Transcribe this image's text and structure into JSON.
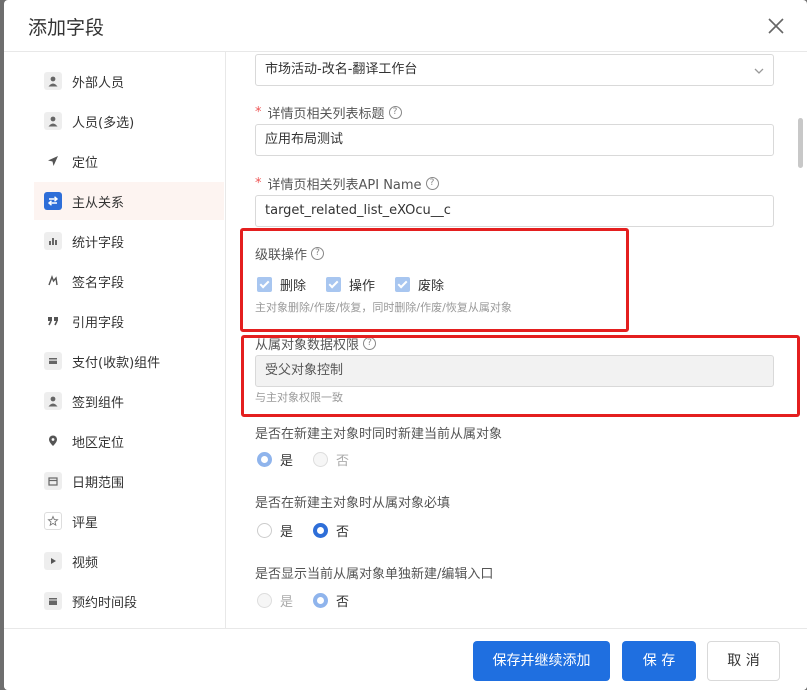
{
  "dialog": {
    "title": "添加字段"
  },
  "sidebar": {
    "items": [
      {
        "label": "外部人员",
        "icon": "person-icon"
      },
      {
        "label": "人员(多选)",
        "icon": "person-icon"
      },
      {
        "label": "定位",
        "icon": "location-arrow-icon"
      },
      {
        "label": "主从关系",
        "icon": "swap-arrows-icon",
        "active": true
      },
      {
        "label": "统计字段",
        "icon": "bar-chart-icon"
      },
      {
        "label": "签名字段",
        "icon": "signature-icon"
      },
      {
        "label": "引用字段",
        "icon": "quote-icon"
      },
      {
        "label": "支付(收款)组件",
        "icon": "payment-icon"
      },
      {
        "label": "签到组件",
        "icon": "checkin-person-icon"
      },
      {
        "label": "地区定位",
        "icon": "map-pin-icon"
      },
      {
        "label": "日期范围",
        "icon": "calendar-icon"
      },
      {
        "label": "评星",
        "icon": "star-icon"
      },
      {
        "label": "视频",
        "icon": "video-play-icon"
      },
      {
        "label": "预约时间段",
        "icon": "schedule-icon"
      }
    ]
  },
  "form": {
    "object_select_value": "市场活动-改名-翻译工作台",
    "related_list_title_label": "详情页相关列表标题",
    "related_list_title_value": "应用布局测试",
    "api_name_label": "详情页相关列表API Name",
    "api_name_value": "target_related_list_eXOcu__c",
    "cascade_label": "级联操作",
    "cascade_options": [
      "删除",
      "操作",
      "废除"
    ],
    "cascade_hint": "主对象删除/作废/恢复，同时删除/作废/恢复从属对象",
    "permission_label": "从属对象数据权限",
    "permission_value": "受父对象控制",
    "permission_hint": "与主对象权限一致",
    "q1_label": "是否在新建主对象时同时新建当前从属对象",
    "q1_yes": "是",
    "q1_no": "否",
    "q2_label": "是否在新建主对象时从属对象必填",
    "q2_yes": "是",
    "q2_no": "否",
    "q3_label": "是否显示当前从属对象单独新建/编辑入口",
    "q3_yes": "是",
    "q3_no": "否",
    "required_mark": "*",
    "help_glyph": "?"
  },
  "footer": {
    "save_continue_label": "保存并继续添加",
    "save_label": "保 存",
    "cancel_label": "取 消"
  },
  "colors": {
    "primary": "#1f6fe0",
    "highlight_border": "#e41f1f",
    "active_sidebar_bg": "#fdf4f1"
  }
}
